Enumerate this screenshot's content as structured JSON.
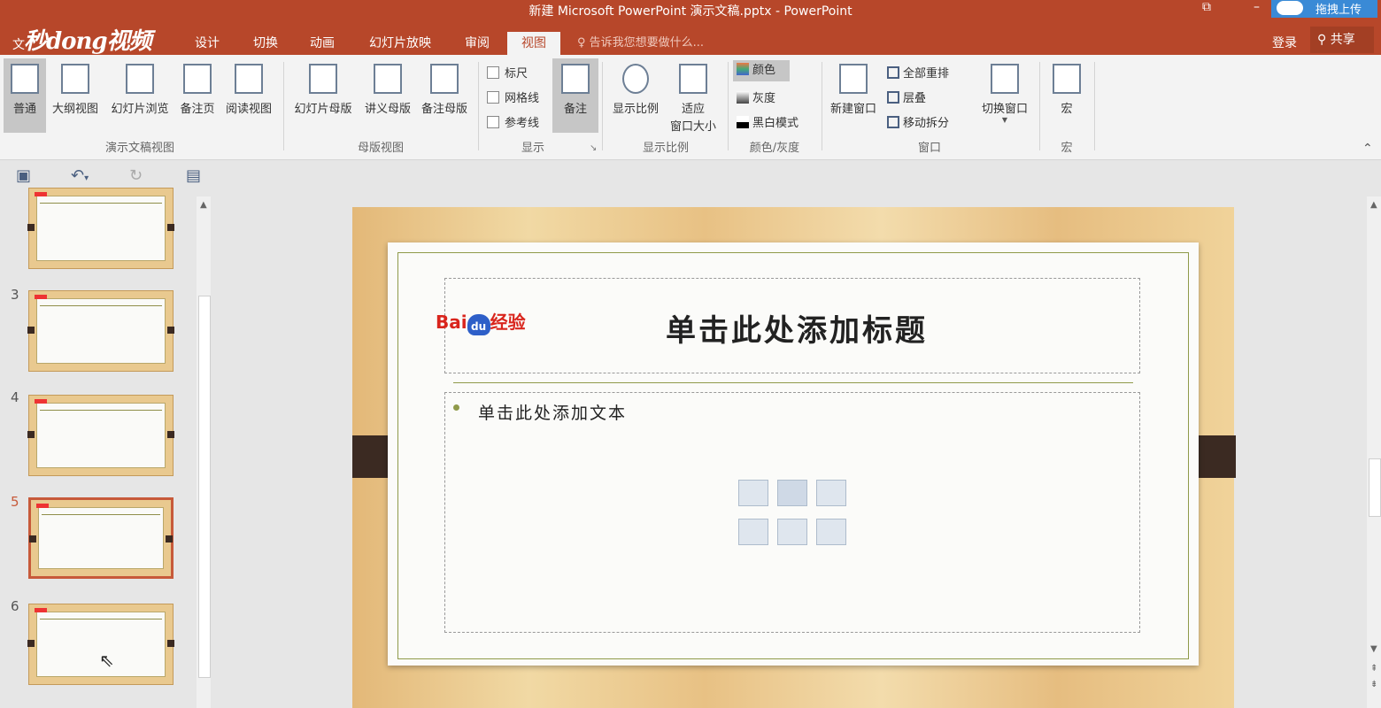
{
  "window": {
    "title": "新建 Microsoft PowerPoint 演示文稿.pptx - PowerPoint",
    "upload_label": "拖拽上传",
    "minimize": "–",
    "restore": "⧉"
  },
  "logo": {
    "prefix": "文",
    "text": "秒dong视频"
  },
  "tabs": [
    "设计",
    "切换",
    "动画",
    "幻灯片放映",
    "审阅",
    "视图"
  ],
  "active_tab": "视图",
  "tell_me": "告诉我您想要做什么...",
  "account": {
    "login": "登录",
    "share": "共享"
  },
  "ribbon": {
    "presentation_views": {
      "group": "演示文稿视图",
      "buttons": [
        "普通",
        "大纲视图",
        "幻灯片浏览",
        "备注页",
        "阅读视图"
      ]
    },
    "master_views": {
      "group": "母版视图",
      "buttons": [
        "幻灯片母版",
        "讲义母版",
        "备注母版"
      ]
    },
    "show": {
      "group": "显示",
      "checkboxes": [
        "标尺",
        "网格线",
        "参考线"
      ],
      "notes": "备注"
    },
    "zoom": {
      "group": "显示比例",
      "zoom": "显示比例",
      "fit_1": "适应",
      "fit_2": "窗口大小"
    },
    "color": {
      "group": "颜色/灰度",
      "items": [
        "颜色",
        "灰度",
        "黑白模式"
      ]
    },
    "window": {
      "group": "窗口",
      "new_window": "新建窗口",
      "items": [
        "全部重排",
        "层叠",
        "移动拆分"
      ],
      "switch": "切换窗口"
    },
    "macros": {
      "group": "宏",
      "button": "宏"
    }
  },
  "thumbnails": [
    "3",
    "4",
    "5",
    "6"
  ],
  "selected_slide": "5",
  "slide": {
    "title_placeholder": "单击此处添加标题",
    "body_placeholder": "单击此处添加文本",
    "watermark": "Bai du 经验"
  }
}
